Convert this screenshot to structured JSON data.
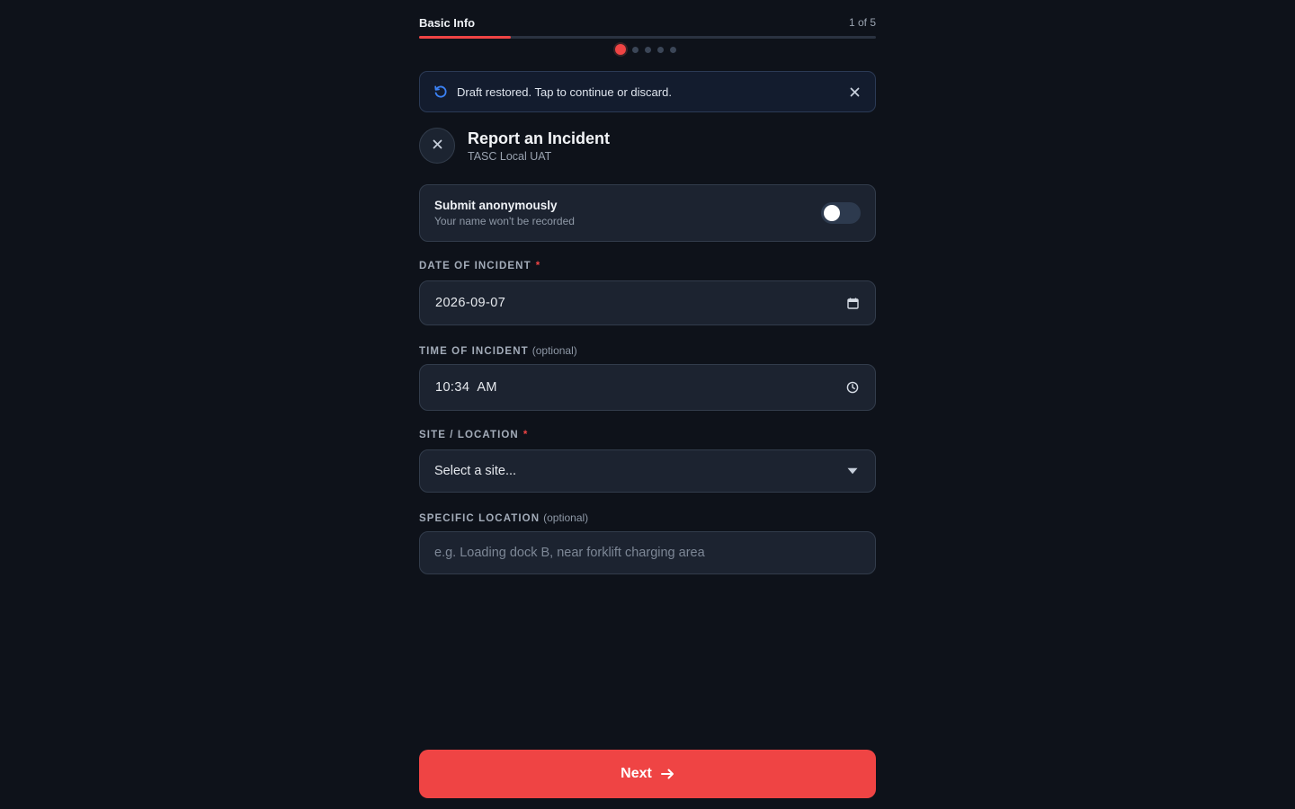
{
  "progress": {
    "step_title": "Basic Info",
    "step_counter": "1 of 5",
    "current_step": 1,
    "total_steps": 5,
    "fill_fraction": 0.2
  },
  "banner": {
    "icon": "restore-icon",
    "text": "Draft restored. Tap to continue or discard.",
    "close_icon": "close-icon"
  },
  "header": {
    "title": "Report an Incident",
    "subtitle": "TASC Local UAT",
    "close_icon": "close-icon"
  },
  "anonymous": {
    "title": "Submit anonymously",
    "subtitle": "Your name won't be recorded",
    "enabled": false
  },
  "fields": {
    "date": {
      "label": "DATE OF INCIDENT",
      "required_mark": "*",
      "value": "2026-09-07",
      "icon": "calendar-icon"
    },
    "time": {
      "label": "TIME OF INCIDENT",
      "optional_text": "(optional)",
      "value": "10:34  AM",
      "icon": "clock-icon"
    },
    "site": {
      "label": "SITE / LOCATION",
      "required_mark": "*",
      "selected": "Select a site...",
      "icon": "caret-down-icon"
    },
    "specific_location": {
      "label": "SPECIFIC LOCATION",
      "optional_text": "(optional)",
      "placeholder": "e.g. Loading dock B, near forklift charging area"
    }
  },
  "next_button": {
    "label": "Next",
    "icon": "arrow-right-icon"
  },
  "colors": {
    "background": "#0e121a",
    "accent": "#ef4444",
    "surface": "#1c2330",
    "border": "#323c4b",
    "banner_bg": "#131c2e",
    "info_icon": "#3b82f6"
  }
}
